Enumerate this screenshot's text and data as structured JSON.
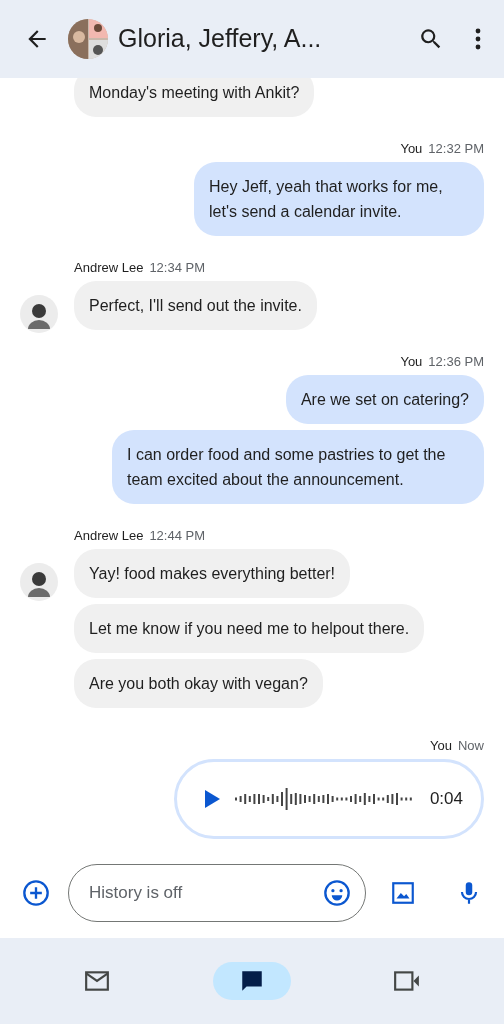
{
  "header": {
    "title": "Gloria, Jeffery, A..."
  },
  "messages": [
    {
      "kind": "incoming",
      "texts": [
        "Monday's meeting with Ankit?"
      ]
    },
    {
      "kind": "outgoing",
      "sender": "You",
      "time": "12:32 PM",
      "texts": [
        "Hey Jeff, yeah that works for me, let's send a calendar invite."
      ]
    },
    {
      "kind": "incoming",
      "sender": "Andrew Lee",
      "time": "12:34 PM",
      "texts": [
        "Perfect, I'll send out the invite."
      ]
    },
    {
      "kind": "outgoing",
      "sender": "You",
      "time": "12:36 PM",
      "texts": [
        "Are we set on catering?",
        "I can order food and some pastries to get the team excited about the announcement."
      ]
    },
    {
      "kind": "incoming",
      "sender": "Andrew Lee",
      "time": "12:44 PM",
      "texts": [
        "Yay! food makes everything better!",
        "Let me know if you need me to helpout there.",
        "Are you both okay with vegan?"
      ]
    },
    {
      "kind": "voice",
      "sender": "You",
      "time": "Now",
      "duration": "0:04"
    }
  ],
  "composer": {
    "placeholder": "History is off"
  },
  "nav": [
    {
      "selected": false
    },
    {
      "selected": true
    },
    {
      "selected": false
    }
  ]
}
